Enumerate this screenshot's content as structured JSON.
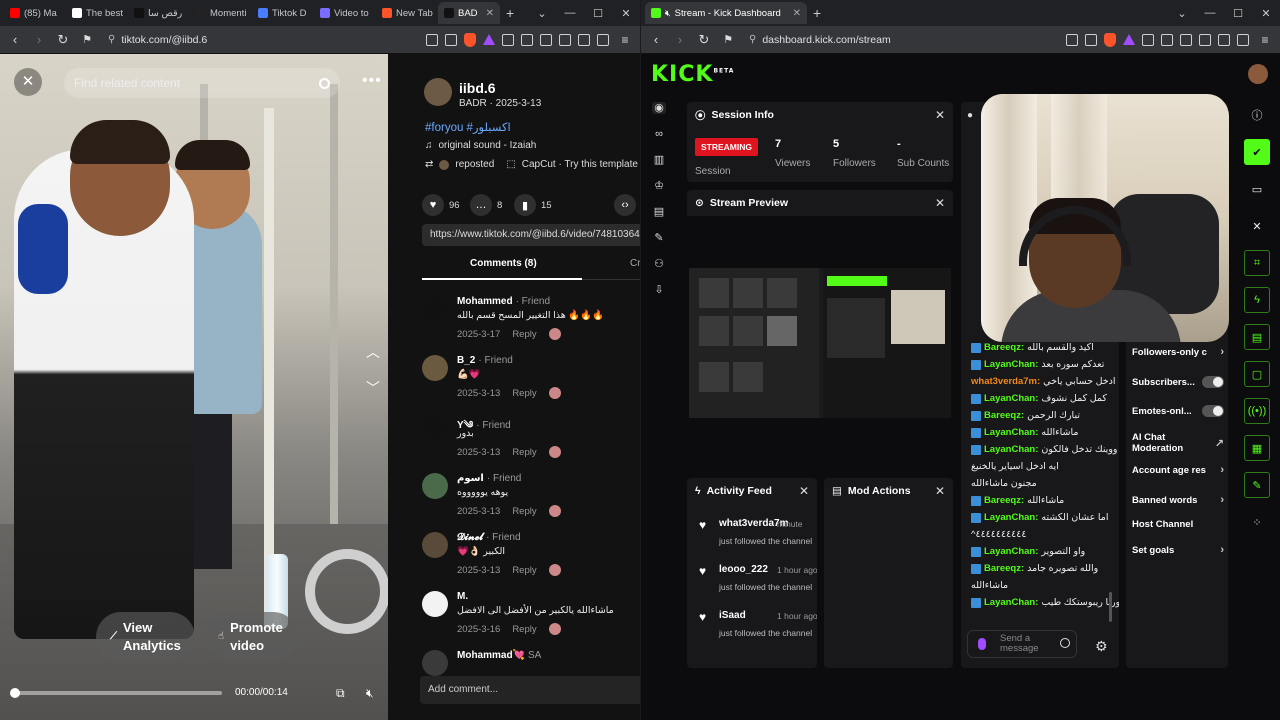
{
  "left_browser": {
    "tabs": [
      {
        "label": "(85) Ma",
        "color": "#ff0000",
        "active": false
      },
      {
        "label": "The best",
        "color": "#ffffff",
        "active": false
      },
      {
        "label": "رقص سا",
        "color": "#111111",
        "active": false
      },
      {
        "label": "Momenti",
        "color": "#222222",
        "active": false
      },
      {
        "label": "Tiktok D",
        "color": "#4a7cff",
        "active": false
      },
      {
        "label": "Video to",
        "color": "#7a6cff",
        "active": false
      },
      {
        "label": "New Tab",
        "color": "#fb542b",
        "active": false
      },
      {
        "label": "BAD",
        "color": "#111111",
        "active": true
      }
    ],
    "url": "tiktok.com/@iibd.6",
    "brave_count": "6"
  },
  "tiktok": {
    "search_placeholder": "Find related content",
    "view_analytics": "View Analytics",
    "promote_video": "Promote video",
    "time": "00:00/00:14",
    "progress": 0.0,
    "username": "iibd.6",
    "subline": "BADR · 2025-3-13",
    "hashtags": "#foryou #اكسبلور",
    "sound": "original sound - Izaiah",
    "reposted": "reposted",
    "capcut": "CapCut · Try this template",
    "likes": "96",
    "comments_count": "8",
    "saves": "15",
    "link": "https://www.tiktok.com/@iibd.6/video/74810364",
    "comments_tab": "Comments (8)",
    "creator_tab": "Cr",
    "add_comment": "Add comment...",
    "comments": [
      {
        "name": "Mohammed",
        "tag": "· Friend",
        "body": "هذا التغيير المسح قسم بالله 🔥🔥🔥",
        "date": "2025-3-17",
        "reply": "Reply",
        "color": "#111111"
      },
      {
        "name": "B_2",
        "tag": "· Friend",
        "body": "💪🏻💗",
        "date": "2025-3-13",
        "reply": "Reply",
        "color": "#6a5a40"
      },
      {
        "name": "Y༄",
        "tag": "· Friend",
        "body": "بدور",
        "date": "2025-3-13",
        "reply": "Reply",
        "color": "#111111"
      },
      {
        "name": "اسوم",
        "tag": "· Friend",
        "body": "يوهه يوووووه",
        "date": "2025-3-13",
        "reply": "Reply",
        "color": "#4a6a4a"
      },
      {
        "name": "𝓓𝓲𝓷𝓮𝓵",
        "tag": "· Friend",
        "body": "💗👌🏻 الكبير",
        "date": "2025-3-13",
        "reply": "Reply",
        "color": "#5a4a3a"
      },
      {
        "name": "M.",
        "tag": "",
        "body": "ماشاءالله يالكبير من الأفضل الى الافضل",
        "date": "2025-3-16",
        "reply": "Reply",
        "color": "#f2f2f2"
      },
      {
        "name": "Mohammad💘",
        "tag": "SA",
        "body": "",
        "date": "",
        "reply": "",
        "color": "#3a3a3a"
      }
    ]
  },
  "right_browser": {
    "tab_label": "Stream - Kick Dashboard",
    "url": "dashboard.kick.com/stream",
    "brave_count": "6"
  },
  "kick": {
    "logo": "KICK",
    "logo_beta": "BETA",
    "session_info": {
      "title": "Session Info",
      "status": "STREAMING",
      "session_label": "Session",
      "viewers_value": "7",
      "viewers_label": "Viewers",
      "followers_value": "5",
      "followers_label": "Followers",
      "subs_value": "-",
      "subs_label": "Sub Counts"
    },
    "stream_preview_title": "Stream Preview",
    "activity_feed": {
      "title": "Activity Feed",
      "items": [
        {
          "user": "what3verda7m",
          "time": "minute",
          "text": "just followed the channel"
        },
        {
          "user": "leooo_222",
          "time": "1 hour ago",
          "text": "just followed the channel"
        },
        {
          "user": "iSaad",
          "time": "1 hour ago",
          "text": "just followed the channel"
        }
      ]
    },
    "mod_actions_title": "Mod Actions",
    "chat": [
      {
        "user": "Bareeqz:",
        "msg": "اكيد والقسم بالله",
        "style": "green",
        "badge": true
      },
      {
        "user": "LayanChan:",
        "msg": "تعدكم سوره بعد",
        "style": "green",
        "badge": true
      },
      {
        "user": "what3verda7m:",
        "msg": "ادخل حسابي ياخي",
        "style": "orange",
        "badge": false
      },
      {
        "user": "LayanChan:",
        "msg": "كمل كمل نشوف",
        "style": "green",
        "badge": true
      },
      {
        "user": "Bareeqz:",
        "msg": "تبارك الرحمن",
        "style": "green",
        "badge": true
      },
      {
        "user": "LayanChan:",
        "msg": "ماشاءالله",
        "style": "green",
        "badge": true
      },
      {
        "user": "LayanChan:",
        "msg": "ووينك تدخل فالكون",
        "style": "green",
        "badge": true
      },
      {
        "user": "",
        "msg": "ايه ادخل اسياير يالخنيغ",
        "style": "green",
        "badge": false
      },
      {
        "user": "",
        "msg": "مجنون ماشاءالله",
        "style": "green",
        "badge": false
      },
      {
        "user": "Bareeqz:",
        "msg": "ماشاءالله",
        "style": "green",
        "badge": true
      },
      {
        "user": "LayanChan:",
        "msg": "اما عشان الكشته",
        "style": "green",
        "badge": true
      },
      {
        "user": "",
        "msg": "^٤٤٤٤٤٤٤٤٤٤",
        "style": "green",
        "badge": false
      },
      {
        "user": "LayanChan:",
        "msg": "واو التصوير",
        "style": "green",
        "badge": true
      },
      {
        "user": "Bareeqz:",
        "msg": "والله تصويره جامد",
        "style": "green",
        "badge": true
      },
      {
        "user": "",
        "msg": "ماشاءالله",
        "style": "green",
        "badge": false
      },
      {
        "user": "LayanChan:",
        "msg": "ورنا ريبوستكك طيب",
        "style": "green",
        "badge": true
      }
    ],
    "send_placeholder": "Send a message",
    "settings": [
      {
        "label": "Followers-only c",
        "control": "chevron"
      },
      {
        "label": "Subscribers...",
        "control": "toggle"
      },
      {
        "label": "Emotes-onl...",
        "control": "toggle"
      },
      {
        "label": "AI Chat Moderation",
        "control": "external"
      },
      {
        "label": "Account age res",
        "control": "chevron"
      },
      {
        "label": "Banned words",
        "control": "chevron"
      },
      {
        "label": "Host Channel",
        "control": "none"
      },
      {
        "label": "Set goals",
        "control": "chevron"
      }
    ]
  },
  "colors": {
    "kick_green": "#53fc18",
    "streaming_red": "#e0141e",
    "tiktok_link": "#6aa8ff"
  }
}
